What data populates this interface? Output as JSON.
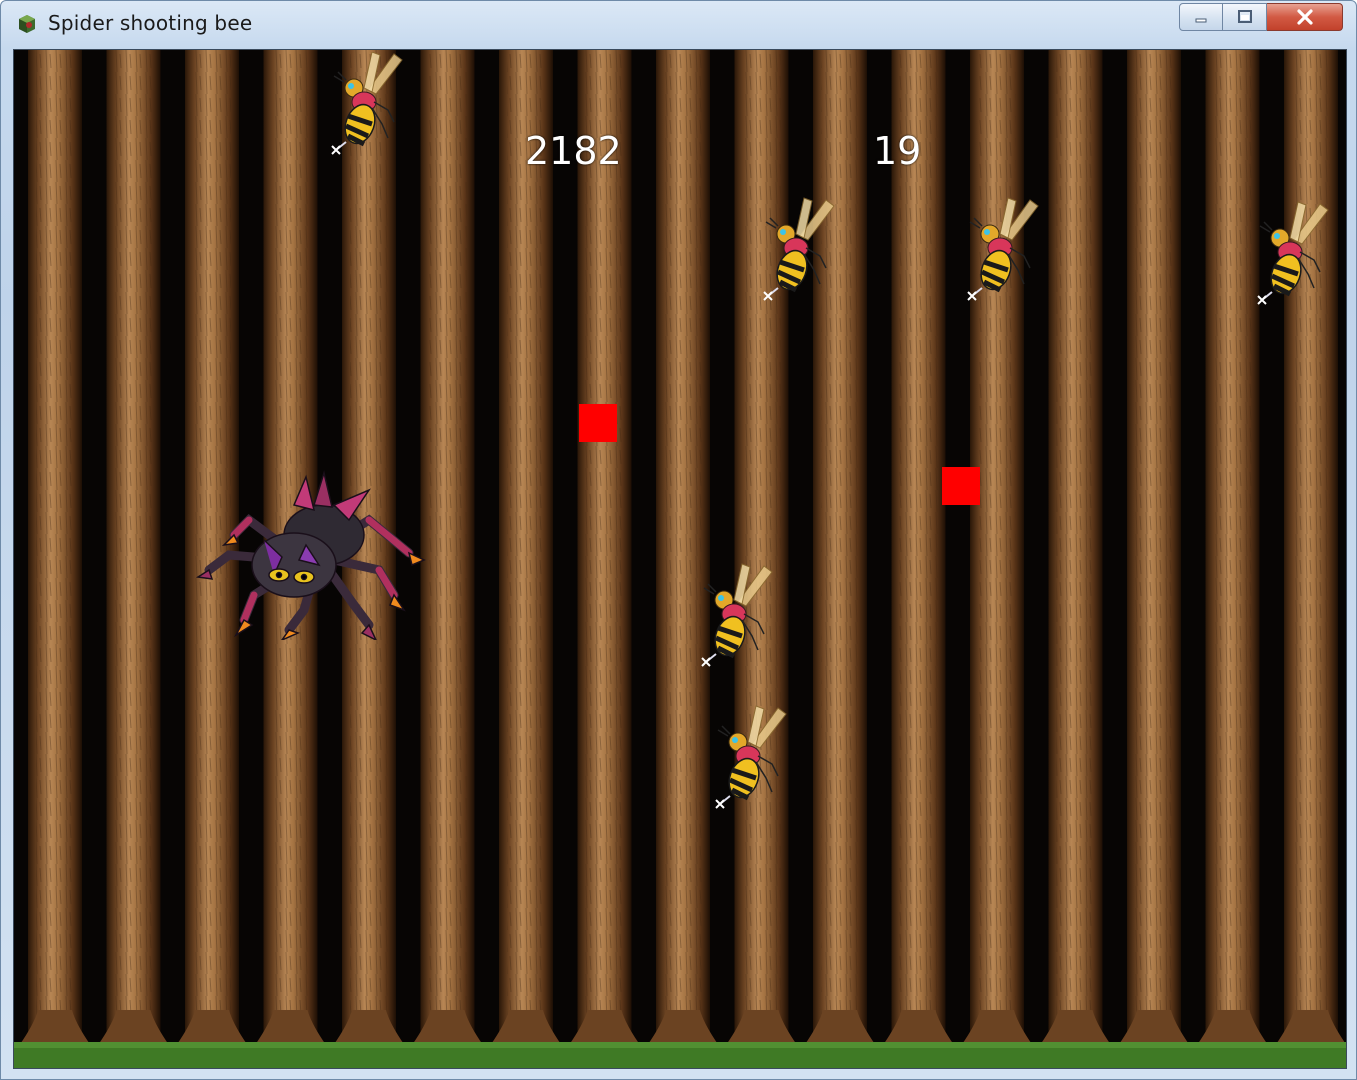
{
  "window": {
    "title": "Spider shooting bee",
    "app_icon": "game-app-icon",
    "controls": [
      "minimize-icon",
      "maximize-icon",
      "close-icon"
    ]
  },
  "hud": {
    "score": "2182",
    "counter": "19"
  },
  "game": {
    "player": "spider",
    "enemies": [
      "bee",
      "bee",
      "bee",
      "bee",
      "bee",
      "bee"
    ],
    "projectiles": [
      "red-square",
      "red-square"
    ],
    "background": "tree-trunks",
    "colors": {
      "projectile": "#ff0000",
      "hud_text": "#ffffff",
      "trunk": "#8a5a30",
      "ground": "#3f7a25"
    }
  }
}
